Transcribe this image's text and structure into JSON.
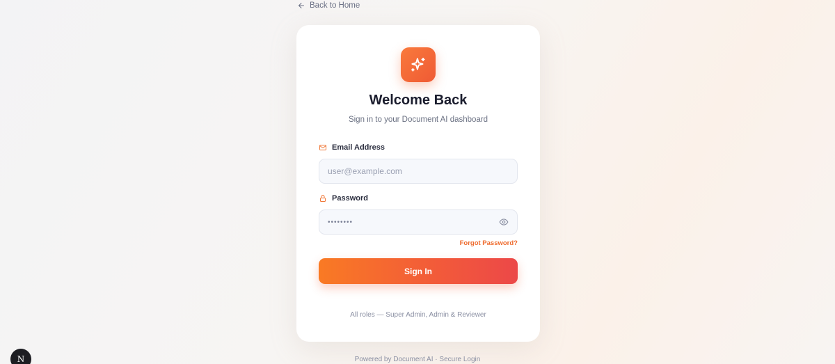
{
  "nav": {
    "back_label": "Back to Home"
  },
  "card": {
    "title": "Welcome Back",
    "subtitle": "Sign in to your Document AI dashboard",
    "logo_icon": "sparkles-icon"
  },
  "form": {
    "email": {
      "label": "Email Address",
      "placeholder": "user@example.com",
      "icon": "mail-icon"
    },
    "password": {
      "label": "Password",
      "value_masked": "••••••••",
      "icon": "lock-icon",
      "toggle_icon": "eye-icon"
    },
    "forgot_label": "Forgot Password?",
    "submit_label": "Sign In"
  },
  "roles_note": "All roles — Super Admin, Admin & Reviewer",
  "footer": "Powered by Document AI · Secure Login",
  "badge": {
    "letter": "N"
  },
  "colors": {
    "accent": "#f26b2f",
    "accent_end": "#ec4848",
    "title": "#1b1d2e"
  }
}
